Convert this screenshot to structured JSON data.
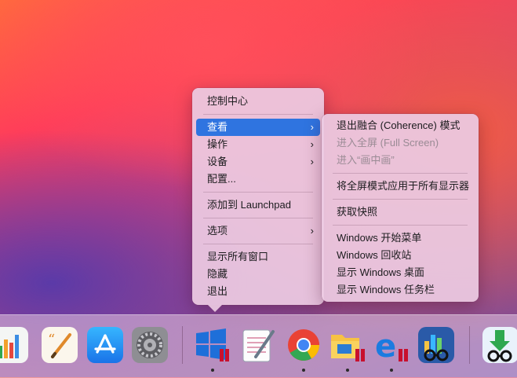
{
  "context_menu": {
    "items": [
      {
        "label": "控制中心"
      },
      {
        "label": "查看",
        "submenu": true,
        "selected": true
      },
      {
        "label": "操作",
        "submenu": true
      },
      {
        "label": "设备",
        "submenu": true
      },
      {
        "label": "配置..."
      },
      {
        "label": "添加到 Launchpad"
      },
      {
        "label": "选项",
        "submenu": true
      },
      {
        "label": "显示所有窗口"
      },
      {
        "label": "隐藏"
      },
      {
        "label": "退出"
      }
    ]
  },
  "submenu": {
    "items": [
      {
        "label": "退出融合 (Coherence) 模式"
      },
      {
        "label": "进入全屏 (Full Screen)",
        "disabled": true
      },
      {
        "label": "进入“画中画”",
        "disabled": true
      },
      {
        "label": "将全屏模式应用于所有显示器"
      },
      {
        "label": "获取快照"
      },
      {
        "label": "Windows 开始菜单"
      },
      {
        "label": "Windows 回收站"
      },
      {
        "label": "显示 Windows 桌面"
      },
      {
        "label": "显示 Windows 任务栏"
      }
    ]
  },
  "dock": {
    "apps": [
      {
        "icon": "numbers-icon",
        "running": false
      },
      {
        "icon": "pages-icon",
        "running": false
      },
      {
        "icon": "app-store-icon",
        "running": false
      },
      {
        "icon": "system-preferences-icon",
        "running": false
      },
      {
        "icon": "windows-parallels-icon",
        "running": true
      },
      {
        "icon": "notepad-icon",
        "running": false
      },
      {
        "icon": "chrome-icon",
        "running": true
      },
      {
        "icon": "file-explorer-icon",
        "running": true
      },
      {
        "icon": "edge-icon",
        "running": true
      },
      {
        "icon": "windows-app-glasses-icon",
        "running": false
      },
      {
        "icon": "downloads-icon",
        "running": false
      }
    ]
  },
  "colors": {
    "selection": "#2f74e0",
    "menu_bg": "#eccae2",
    "dock_bg": "#e6c8e1"
  }
}
